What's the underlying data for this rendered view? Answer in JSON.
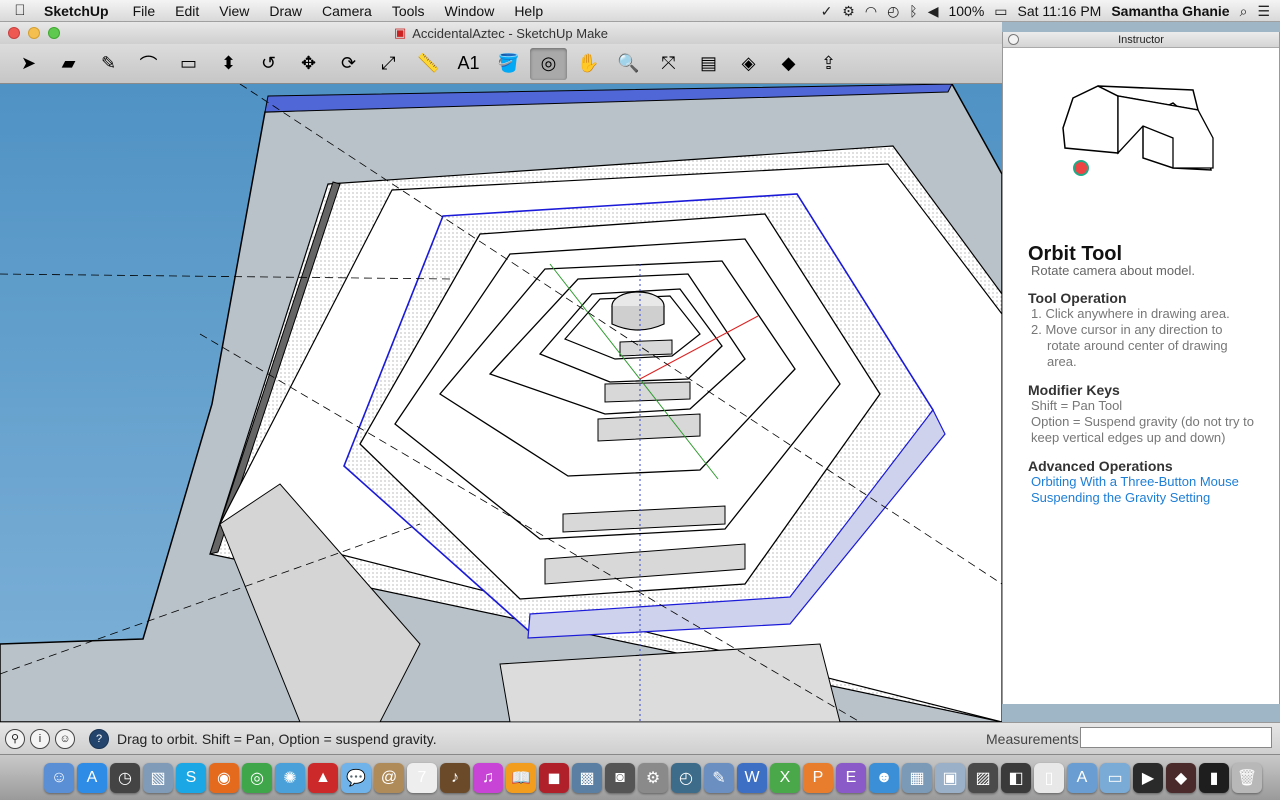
{
  "menubar": {
    "apple_icon": "apple-icon",
    "app_name": "SketchUp",
    "items": [
      "File",
      "Edit",
      "View",
      "Draw",
      "Camera",
      "Tools",
      "Window",
      "Help"
    ],
    "battery": "100%",
    "clock": "Sat 11:16 PM",
    "user": "Samantha Ghanie"
  },
  "window": {
    "title": "AccidentalAztec - SketchUp Make"
  },
  "toolbar": {
    "tools": [
      {
        "name": "select-tool-icon",
        "glyph": "➤"
      },
      {
        "name": "eraser-tool-icon",
        "glyph": "▰"
      },
      {
        "name": "pencil-tool-icon",
        "glyph": "✎"
      },
      {
        "name": "arc-tool-icon",
        "glyph": "⌒"
      },
      {
        "name": "rectangle-tool-icon",
        "glyph": "▭"
      },
      {
        "name": "push-pull-tool-icon",
        "glyph": "⬍"
      },
      {
        "name": "offset-tool-icon",
        "glyph": "↺"
      },
      {
        "name": "move-tool-icon",
        "glyph": "✥"
      },
      {
        "name": "rotate-tool-icon",
        "glyph": "⟳"
      },
      {
        "name": "scale-tool-icon",
        "glyph": "⤢"
      },
      {
        "name": "tape-measure-tool-icon",
        "glyph": "📏"
      },
      {
        "name": "text-tool-icon",
        "glyph": "A1"
      },
      {
        "name": "paint-bucket-tool-icon",
        "glyph": "🪣"
      },
      {
        "name": "orbit-tool-icon",
        "glyph": "◎"
      },
      {
        "name": "pan-tool-icon",
        "glyph": "✋"
      },
      {
        "name": "zoom-tool-icon",
        "glyph": "🔍"
      },
      {
        "name": "zoom-extents-tool-icon",
        "glyph": "⤧"
      },
      {
        "name": "model-info-tool-icon",
        "glyph": "▤"
      },
      {
        "name": "components-tool-icon",
        "glyph": "◈"
      },
      {
        "name": "warehouse-tool-icon",
        "glyph": "◆"
      },
      {
        "name": "share-model-tool-icon",
        "glyph": "⇪"
      }
    ]
  },
  "status": {
    "message": "Drag to orbit. Shift = Pan, Option = suspend gravity.",
    "measurements_label": "Measurements",
    "measurements_value": ""
  },
  "instructor": {
    "title": "Instructor",
    "heading": "Orbit Tool",
    "subheading": "Rotate camera about model.",
    "tool_operation_title": "Tool Operation",
    "step1": "1.  Click anywhere in drawing area.",
    "step2": "2.  Move cursor in any direction to",
    "step2b": "rotate around center of drawing",
    "step2c": "area.",
    "modifier_title": "Modifier Keys",
    "modifier1": "Shift = Pan Tool",
    "modifier2": "Option = Suspend gravity (do not try to",
    "modifier2b": "keep vertical edges up and down)",
    "advanced_title": "Advanced Operations",
    "link1": "Orbiting With a Three-Button Mouse",
    "link2": "Suspending the Gravity Setting"
  },
  "dock": {
    "apps": [
      {
        "name": "finder-icon",
        "color": "#5a8fd6",
        "glyph": "☺"
      },
      {
        "name": "app-store-icon",
        "color": "#2e8ce6",
        "glyph": "A"
      },
      {
        "name": "dashboard-icon",
        "color": "#444444",
        "glyph": "◷"
      },
      {
        "name": "preview-icon",
        "color": "#7f9bb8",
        "glyph": "▧"
      },
      {
        "name": "skype-icon",
        "color": "#1ba7e5",
        "glyph": "S"
      },
      {
        "name": "firefox-icon",
        "color": "#e46a1e",
        "glyph": "◉"
      },
      {
        "name": "chrome-icon",
        "color": "#3fa64a",
        "glyph": "◎"
      },
      {
        "name": "safari-icon",
        "color": "#4aa0d8",
        "glyph": "✺"
      },
      {
        "name": "sketchup-icon",
        "color": "#cc2a2a",
        "glyph": "▲"
      },
      {
        "name": "messages-icon",
        "color": "#6fb3ea",
        "glyph": "💬"
      },
      {
        "name": "contacts-icon",
        "color": "#b08b5a",
        "glyph": "@"
      },
      {
        "name": "calendar-icon",
        "color": "#eeeeee",
        "glyph": "7"
      },
      {
        "name": "garageband-icon",
        "color": "#6b4a2a",
        "glyph": "♪"
      },
      {
        "name": "itunes-icon",
        "color": "#c744d6",
        "glyph": "♫"
      },
      {
        "name": "ibooks-icon",
        "color": "#f29d1e",
        "glyph": "📖"
      },
      {
        "name": "photo-booth-icon",
        "color": "#b0202a",
        "glyph": "◼"
      },
      {
        "name": "iphoto-icon",
        "color": "#5b7fa3",
        "glyph": "▩"
      },
      {
        "name": "image-capture-icon",
        "color": "#555555",
        "glyph": "◙"
      },
      {
        "name": "system-preferences-icon",
        "color": "#8a8a8a",
        "glyph": "⚙"
      },
      {
        "name": "time-machine-icon",
        "color": "#3c6c8a",
        "glyph": "◴"
      },
      {
        "name": "textedit-icon",
        "color": "#6a8fc0",
        "glyph": "✎"
      },
      {
        "name": "word-icon",
        "color": "#3d6fc4",
        "glyph": "W"
      },
      {
        "name": "excel-icon",
        "color": "#4aa84a",
        "glyph": "X"
      },
      {
        "name": "powerpoint-icon",
        "color": "#e87d2e",
        "glyph": "P"
      },
      {
        "name": "entourage-icon",
        "color": "#8a5ac8",
        "glyph": "E"
      },
      {
        "name": "messenger-icon",
        "color": "#3a8fd6",
        "glyph": "☻"
      },
      {
        "name": "calculator-icon",
        "color": "#7a9ab8",
        "glyph": "▦"
      },
      {
        "name": "grab-icon",
        "color": "#9ab0c8",
        "glyph": "▣"
      },
      {
        "name": "photo-icon",
        "color": "#4a4a4a",
        "glyph": "▨"
      },
      {
        "name": "comic-icon",
        "color": "#3a3a3a",
        "glyph": "◧"
      },
      {
        "name": "document-icon",
        "color": "#e8e8e8",
        "glyph": "▯"
      },
      {
        "name": "applications-folder-icon",
        "color": "#6a9ed2",
        "glyph": "A"
      },
      {
        "name": "documents-folder-icon",
        "color": "#7aaad6",
        "glyph": "▭"
      },
      {
        "name": "movie-icon",
        "color": "#2a2a2a",
        "glyph": "▶"
      },
      {
        "name": "game-icon",
        "color": "#4a2a2a",
        "glyph": "◆"
      },
      {
        "name": "terminal-icon",
        "color": "#1e1e1e",
        "glyph": "▮"
      },
      {
        "name": "trash-icon",
        "color": "#b8b8b8",
        "glyph": "🗑"
      }
    ]
  }
}
